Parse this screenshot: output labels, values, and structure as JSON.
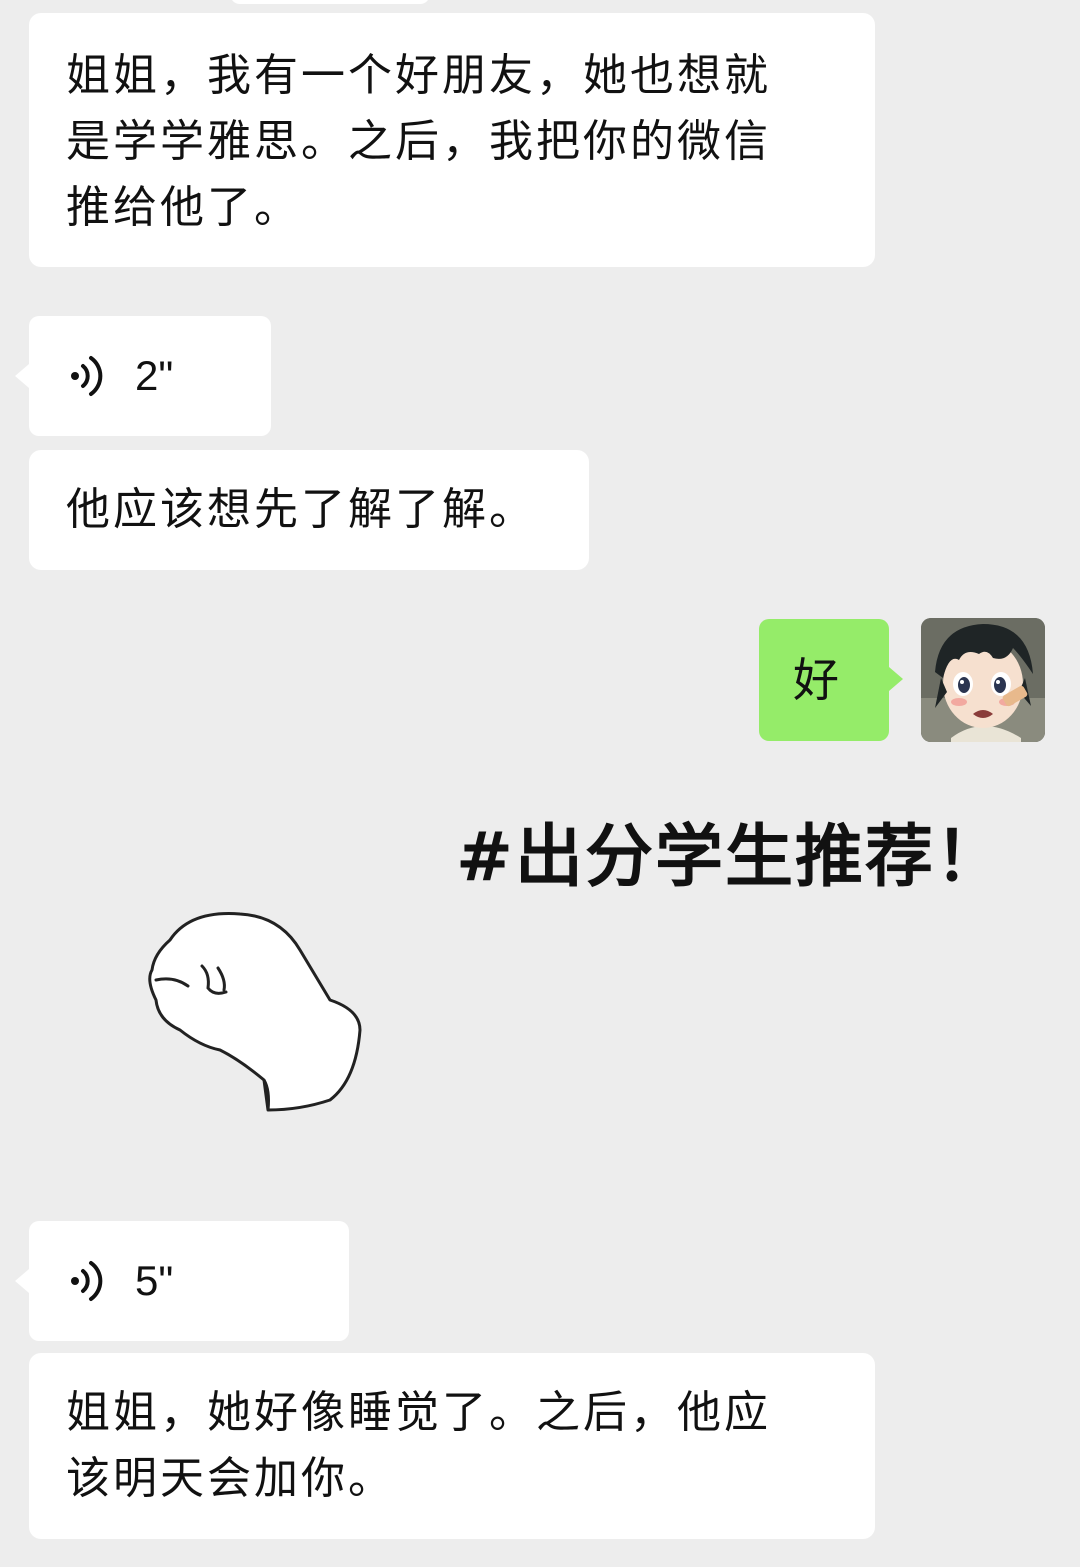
{
  "messages": [
    {
      "type": "text",
      "text": "姐姐，我有一个好朋友，她也想就\n是学学雅思。之后，我把你的微信\n推给他了。"
    },
    {
      "type": "voice",
      "duration": "2\""
    },
    {
      "type": "text",
      "text": "他应该想先了解了解。"
    },
    {
      "type": "outgoing_text",
      "text": "好"
    },
    {
      "type": "voice",
      "duration": "5\""
    },
    {
      "type": "text",
      "text": "姐姐，她好像睡觉了。之后，他应\n该明天会加你。"
    }
  ],
  "overlay": {
    "hashtag": "#出分学生推荐！"
  },
  "icons": {
    "voice": "voice-wave-icon",
    "avatar": "anime-boy-avatar",
    "sticker": "fist-sticker"
  },
  "colors": {
    "background": "#ededed",
    "incoming_bubble": "#ffffff",
    "outgoing_bubble": "#95ec69",
    "text": "#111111"
  }
}
